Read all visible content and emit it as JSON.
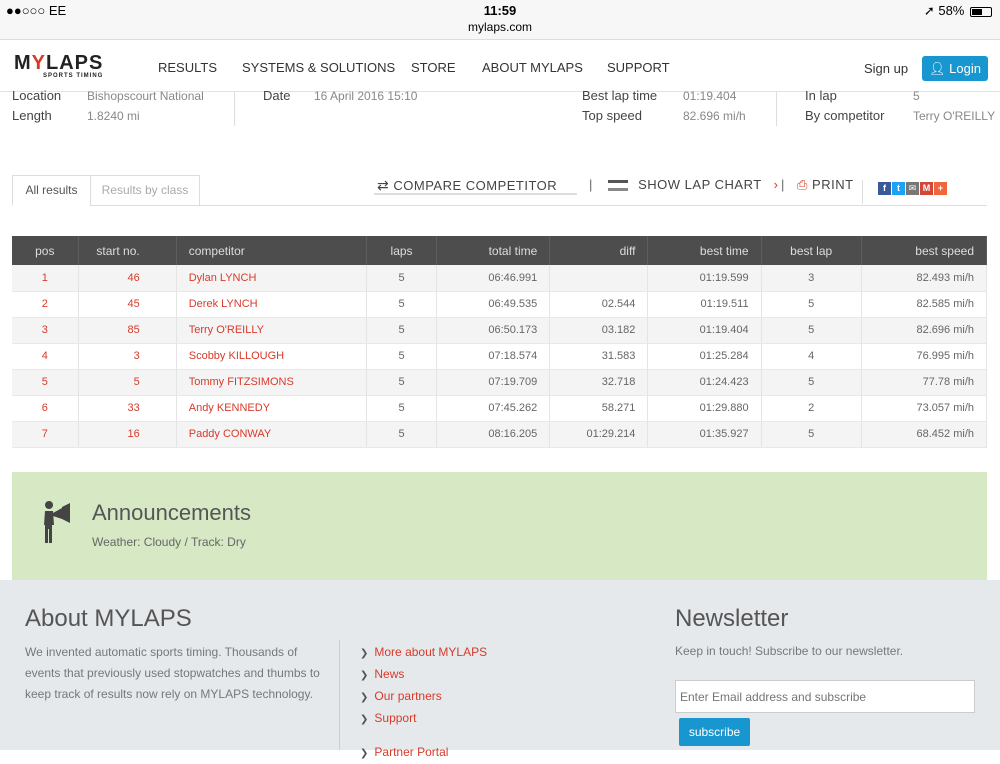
{
  "status": {
    "carrier": "●●○○○ EE",
    "time": "11:59",
    "url": "mylaps.com",
    "battery": "58%",
    "battery_level": 0.58
  },
  "nav": {
    "logo_main_pre": "M",
    "logo_main_y": "Y",
    "logo_main_post": "LAPS",
    "logo_sub": "SPORTS TIMING",
    "items": [
      "RESULTS",
      "SYSTEMS & SOLUTIONS",
      "STORE",
      "ABOUT MYLAPS",
      "SUPPORT"
    ],
    "signup": "Sign up",
    "login": "Login"
  },
  "event": {
    "location_label": "Location",
    "location_value": "Bishopscourt National",
    "length_label": "Length",
    "length_value": "1.8240 mi",
    "date_label": "Date",
    "date_value": "16 April 2016 15:10",
    "best_lap_label": "Best lap time",
    "best_lap_value": "01:19.404",
    "top_speed_label": "Top speed",
    "top_speed_value": "82.696 mi/h",
    "in_lap_label": "In lap",
    "in_lap_value": "5",
    "by_comp_label": "By competitor",
    "by_comp_value": "Terry O'REILLY"
  },
  "tabs": {
    "all": "All results",
    "by_class": "Results by class"
  },
  "actions": {
    "compare": "COMPARE COMPETITOR",
    "lap_chart": "SHOW LAP CHART",
    "print": "PRINT",
    "pipe": "|"
  },
  "share": [
    {
      "name": "facebook",
      "glyph": "f",
      "color": "#3b5998"
    },
    {
      "name": "twitter",
      "glyph": "t",
      "color": "#1da1f2"
    },
    {
      "name": "email",
      "glyph": "✉",
      "color": "#777777"
    },
    {
      "name": "gmail",
      "glyph": "M",
      "color": "#d44638"
    },
    {
      "name": "more",
      "glyph": "+",
      "color": "#f0653c"
    }
  ],
  "table": {
    "headers": [
      "pos",
      "start no.",
      "competitor",
      "laps",
      "total time",
      "diff",
      "best time",
      "best lap",
      "best speed"
    ],
    "rows": [
      [
        "1",
        "46",
        "Dylan LYNCH",
        "5",
        "06:46.991",
        "",
        "01:19.599",
        "3",
        "82.493 mi/h"
      ],
      [
        "2",
        "45",
        "Derek LYNCH",
        "5",
        "06:49.535",
        "02.544",
        "01:19.511",
        "5",
        "82.585 mi/h"
      ],
      [
        "3",
        "85",
        "Terry O'REILLY",
        "5",
        "06:50.173",
        "03.182",
        "01:19.404",
        "5",
        "82.696 mi/h"
      ],
      [
        "4",
        "3",
        "Scobby KILLOUGH",
        "5",
        "07:18.574",
        "31.583",
        "01:25.284",
        "4",
        "76.995 mi/h"
      ],
      [
        "5",
        "5",
        "Tommy FITZSIMONS",
        "5",
        "07:19.709",
        "32.718",
        "01:24.423",
        "5",
        "77.78 mi/h"
      ],
      [
        "6",
        "33",
        "Andy KENNEDY",
        "5",
        "07:45.262",
        "58.271",
        "01:29.880",
        "2",
        "73.057 mi/h"
      ],
      [
        "7",
        "16",
        "Paddy CONWAY",
        "5",
        "08:16.205",
        "01:29.214",
        "01:35.927",
        "5",
        "68.452 mi/h"
      ]
    ]
  },
  "announce": {
    "title": "Announcements",
    "text": "Weather: Cloudy / Track: Dry"
  },
  "footer": {
    "about_title": "About MYLAPS",
    "about_text": "We invented automatic sports timing. Thousands of events that previously used stopwatches and thumbs to keep track of results now rely on MYLAPS technology.",
    "links": [
      "More about MYLAPS",
      "News",
      "Our partners",
      "Support",
      "Partner Portal"
    ],
    "news_title": "Newsletter",
    "news_text": "Keep in touch! Subscribe to our newsletter.",
    "news_placeholder": "Enter Email address and subscribe",
    "subscribe": "subscribe"
  }
}
